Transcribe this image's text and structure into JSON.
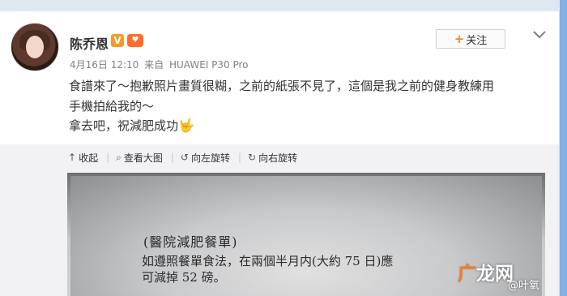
{
  "post": {
    "username": "陈乔恩",
    "vip_badge": "V",
    "level_badge": "♥",
    "follow_label": "关注",
    "follow_plus": "+",
    "timestamp": "4月16日 12:10",
    "source_prefix": "来自",
    "source_device": "HUAWEI P30 Pro",
    "lines": [
      "食譜來了～抱歉照片畫質很糊，之前的紙張不見了，這個是我之前的健身教練用",
      "手機拍給我的～",
      "拿去吧，祝減肥成功"
    ],
    "line3_emoji": "🤟"
  },
  "toolbar": {
    "collapse_label": "收起",
    "view_large_label": "查看大图",
    "rotate_left_label": "向左旋转",
    "rotate_right_label": "向右旋转"
  },
  "photo": {
    "doc_title": "(醫院減肥餐單)",
    "doc_line1": "如遵照餐單食法，在兩個半月内(大約 75 日)應",
    "doc_line2": "可減掉 52 磅。"
  },
  "watermark": {
    "logo": "广",
    "text": "龙网",
    "sub": "@叶氧"
  },
  "colors": {
    "accent": "#ff8140",
    "meta_text": "#808080",
    "body_text": "#333333"
  },
  "icons": {
    "collapse": "up-arrow-icon",
    "view_large": "magnify-icon",
    "rotate_left": "rotate-left-icon",
    "rotate_right": "rotate-right-icon",
    "more": "chevron-down-icon"
  }
}
